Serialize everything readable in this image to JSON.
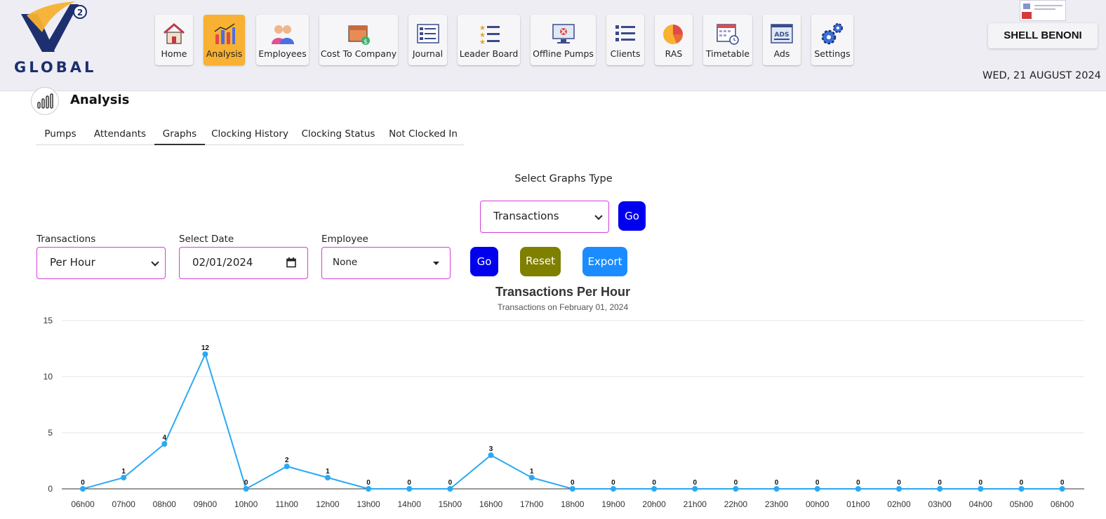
{
  "logo": {
    "text": "GLOBAL",
    "badge": "2"
  },
  "nav": [
    {
      "label": "Home",
      "icon": "home-icon",
      "active": false
    },
    {
      "label": "Analysis",
      "icon": "analysis-icon",
      "active": true
    },
    {
      "label": "Employees",
      "icon": "employees-icon",
      "active": false
    },
    {
      "label": "Cost To Company",
      "icon": "cost-box-icon",
      "active": false
    },
    {
      "label": "Journal",
      "icon": "journal-icon",
      "active": false
    },
    {
      "label": "Leader Board",
      "icon": "leaderboard-icon",
      "active": false
    },
    {
      "label": "Offline Pumps",
      "icon": "offline-monitor-icon",
      "active": false
    },
    {
      "label": "Clients",
      "icon": "clients-list-icon",
      "active": false
    },
    {
      "label": "RAS",
      "icon": "pie-chart-icon",
      "active": false
    },
    {
      "label": "Timetable",
      "icon": "timetable-icon",
      "active": false
    },
    {
      "label": "Ads",
      "icon": "ads-icon",
      "active": false
    },
    {
      "label": "Settings",
      "icon": "gears-icon",
      "active": false
    }
  ],
  "header": {
    "user": "SHELL BENONI",
    "date": "WED, 21 AUGUST 2024"
  },
  "page": {
    "title": "Analysis"
  },
  "tabs": [
    {
      "label": "Pumps",
      "active": false
    },
    {
      "label": "Attendants",
      "active": false
    },
    {
      "label": "Graphs",
      "active": true
    },
    {
      "label": "Clocking History",
      "active": false
    },
    {
      "label": "Clocking Status",
      "active": false
    },
    {
      "label": "Not Clocked In",
      "active": false
    }
  ],
  "graph_type": {
    "label": "Select Graphs Type",
    "selected": "Transactions",
    "go_label": "Go"
  },
  "filters": {
    "transactions_label": "Transactions",
    "transactions_value": "Per Hour",
    "date_label": "Select Date",
    "date_value": "02/01/2024",
    "employee_label": "Employee",
    "employee_value": "None",
    "go_label": "Go",
    "reset_label": "Reset",
    "export_label": "Export"
  },
  "colors": {
    "accent": "#f8b132",
    "line": "#2aa9f4",
    "go": "#0000ee",
    "reset": "#7f7f00",
    "export": "#1a8cff",
    "select_border": "#d43fd4"
  },
  "chart_data": {
    "type": "line",
    "title": "Transactions Per Hour",
    "subtitle": "Transactions on February 01, 2024",
    "categories": [
      "06h00",
      "07h00",
      "08h00",
      "09h00",
      "10h00",
      "11h00",
      "12h00",
      "13h00",
      "14h00",
      "15h00",
      "16h00",
      "17h00",
      "18h00",
      "19h00",
      "20h00",
      "21h00",
      "22h00",
      "23h00",
      "00h00",
      "01h00",
      "02h00",
      "03h00",
      "04h00",
      "05h00",
      "06h00"
    ],
    "values": [
      0,
      1,
      4,
      12,
      0,
      2,
      1,
      0,
      0,
      0,
      3,
      1,
      0,
      0,
      0,
      0,
      0,
      0,
      0,
      0,
      0,
      0,
      0,
      0,
      0
    ],
    "yticks": [
      0,
      5,
      10,
      15
    ],
    "ylim": [
      0,
      15
    ],
    "grid": true,
    "data_labels": true
  }
}
